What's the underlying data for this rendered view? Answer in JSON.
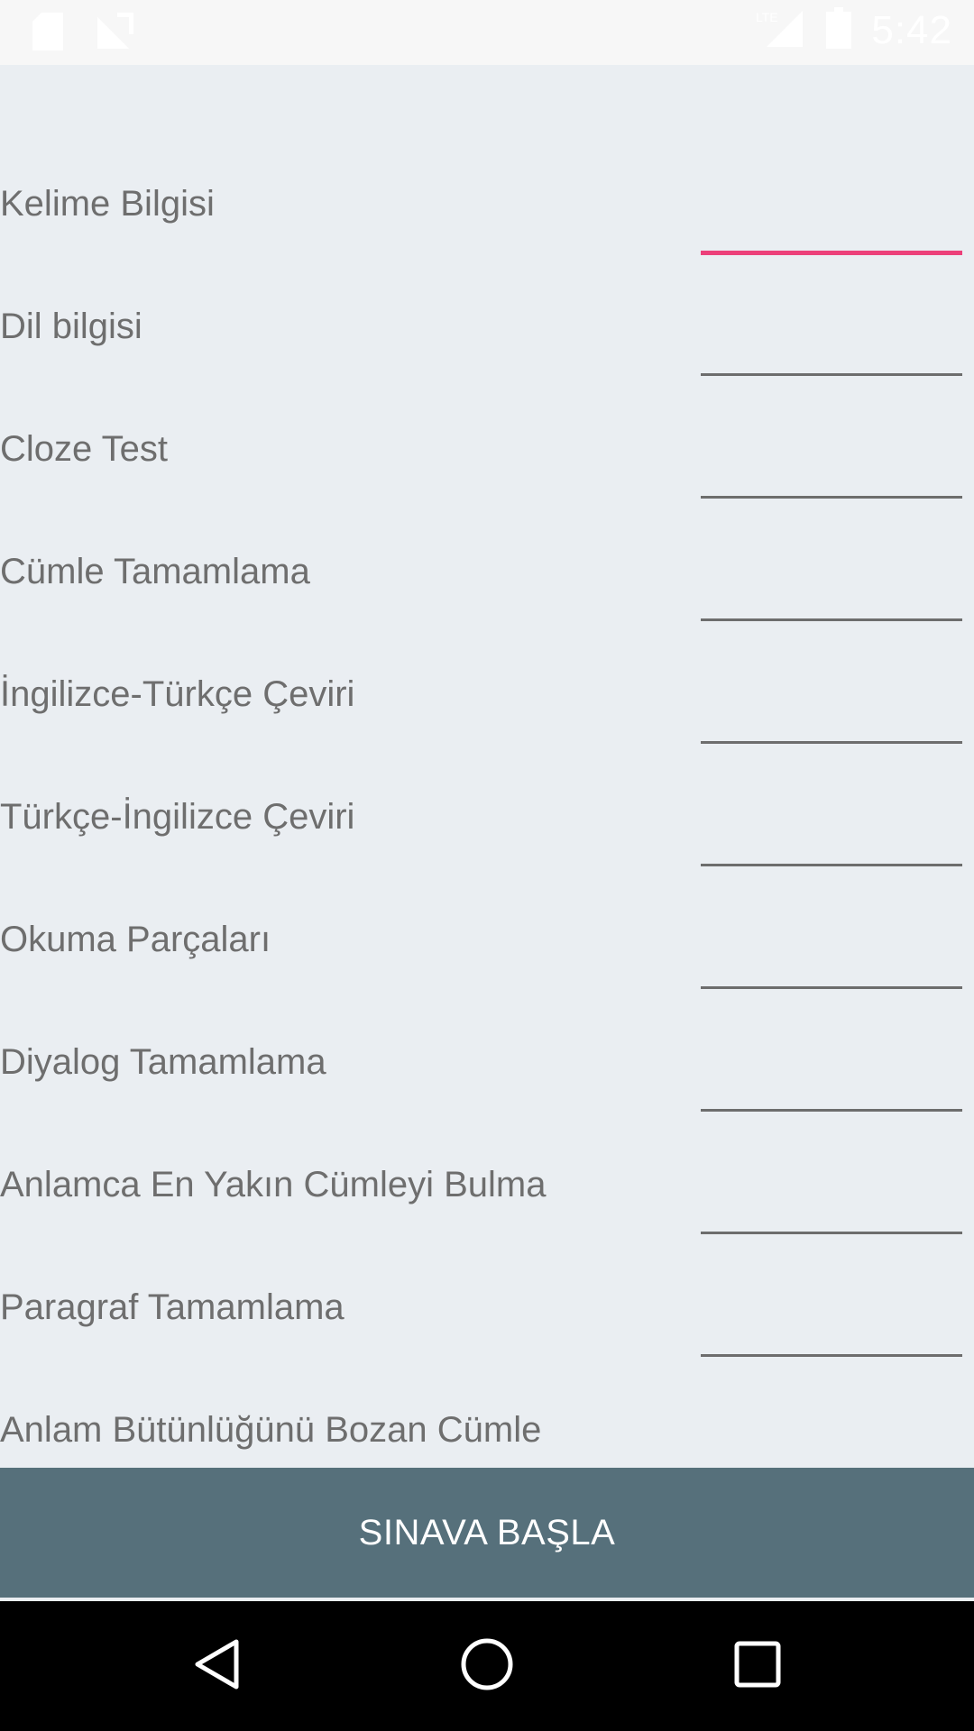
{
  "status_bar": {
    "time": "5:42",
    "network": "LTE",
    "icons": [
      "sd-card-icon",
      "no-signal-icon",
      "cell-signal-icon",
      "battery-icon"
    ]
  },
  "form": {
    "rows": [
      {
        "label": "Kelime Bilgisi",
        "value": ""
      },
      {
        "label": "Dil bilgisi",
        "value": ""
      },
      {
        "label": "Cloze Test",
        "value": ""
      },
      {
        "label": "Cümle Tamamlama",
        "value": ""
      },
      {
        "label": "İngilizce-Türkçe Çeviri",
        "value": ""
      },
      {
        "label": "Türkçe-İngilizce Çeviri",
        "value": ""
      },
      {
        "label": "Okuma Parçaları",
        "value": ""
      },
      {
        "label": "Diyalog Tamamlama",
        "value": ""
      },
      {
        "label": "Anlamca En Yakın Cümleyi Bulma",
        "value": ""
      },
      {
        "label": "Paragraf Tamamlama",
        "value": ""
      },
      {
        "label": "Anlam Bütünlüğünü Bozan Cümle",
        "value": ""
      }
    ]
  },
  "action": {
    "start_label": "SINAVA BAŞLA"
  },
  "nav": {
    "icons": [
      "back-icon",
      "home-icon",
      "recents-icon"
    ]
  },
  "colors": {
    "background": "#eaeef2",
    "accent": "#ec407a",
    "button": "#56707b",
    "label": "#6e6e6e"
  }
}
